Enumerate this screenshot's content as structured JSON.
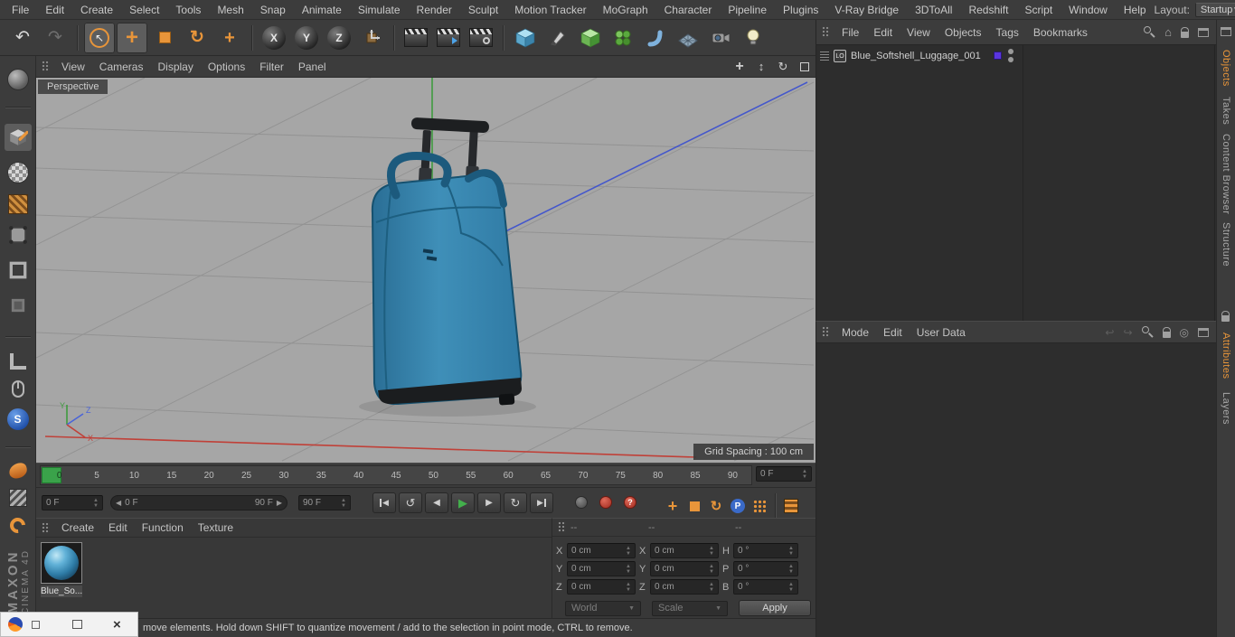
{
  "app": {
    "branding_top": "MAXON",
    "branding_bottom": "CINEMA 4D"
  },
  "menubar": {
    "items": [
      "File",
      "Edit",
      "Create",
      "Select",
      "Tools",
      "Mesh",
      "Snap",
      "Animate",
      "Simulate",
      "Render",
      "Sculpt",
      "Motion Tracker",
      "MoGraph",
      "Character",
      "Pipeline",
      "Plugins",
      "V-Ray Bridge",
      "3DToAll",
      "Redshift",
      "Script",
      "Window",
      "Help"
    ],
    "layout_label": "Layout:",
    "layout_value": "Startup"
  },
  "toolbar": {
    "axis_x": "X",
    "axis_y": "Y",
    "axis_z": "Z"
  },
  "viewport": {
    "menu": [
      "View",
      "Cameras",
      "Display",
      "Options",
      "Filter",
      "Panel"
    ],
    "camera_label": "Perspective",
    "grid_spacing": "Grid Spacing : 100 cm",
    "axis": {
      "x": "X",
      "y": "Y",
      "z": "Z"
    }
  },
  "object_manager": {
    "menu": [
      "File",
      "Edit",
      "View",
      "Objects",
      "Tags",
      "Bookmarks"
    ],
    "objects": [
      {
        "name": "Blue_Softshell_Luggage_001"
      }
    ]
  },
  "attribute_manager": {
    "menu": [
      "Mode",
      "Edit",
      "User Data"
    ]
  },
  "side_tabs": {
    "top": [
      "Objects",
      "Takes",
      "Content Browser",
      "Structure"
    ],
    "bottom": [
      "Attributes",
      "Layers"
    ]
  },
  "timeline": {
    "ticks": [
      "0",
      "5",
      "10",
      "15",
      "20",
      "25",
      "30",
      "35",
      "40",
      "45",
      "50",
      "55",
      "60",
      "65",
      "70",
      "75",
      "80",
      "85",
      "90"
    ],
    "current_frame": "0 F"
  },
  "animation": {
    "start_frame": "0 F",
    "range_start": "0 F",
    "range_end": "90 F",
    "end_frame": "90 F",
    "parameter_label": "P",
    "help_label": "?"
  },
  "material_manager": {
    "menu": [
      "Create",
      "Edit",
      "Function",
      "Texture"
    ],
    "materials": [
      {
        "name": "Blue_So..."
      }
    ]
  },
  "coordinates": {
    "headers": [
      "--",
      "--",
      "--"
    ],
    "position": {
      "labels": [
        "X",
        "Y",
        "Z"
      ],
      "values": [
        "0 cm",
        "0 cm",
        "0 cm"
      ]
    },
    "size": {
      "labels": [
        "X",
        "Y",
        "Z"
      ],
      "values": [
        "0 cm",
        "0 cm",
        "0 cm"
      ]
    },
    "rotation": {
      "labels": [
        "H",
        "P",
        "B"
      ],
      "values": [
        "0 °",
        "0 °",
        "0 °"
      ]
    },
    "system": "World",
    "mode": "Scale",
    "apply": "Apply"
  },
  "statusbar": {
    "text": "move elements. Hold down SHIFT to quantize movement / add to the selection in point mode, CTRL to remove."
  },
  "snap_label": "S",
  "colors": {
    "accent_orange": "#e8953a",
    "viewport_bg": "#a6a6a6",
    "luggage_blue": "#2e7ea8",
    "play_green": "#43b04c"
  }
}
